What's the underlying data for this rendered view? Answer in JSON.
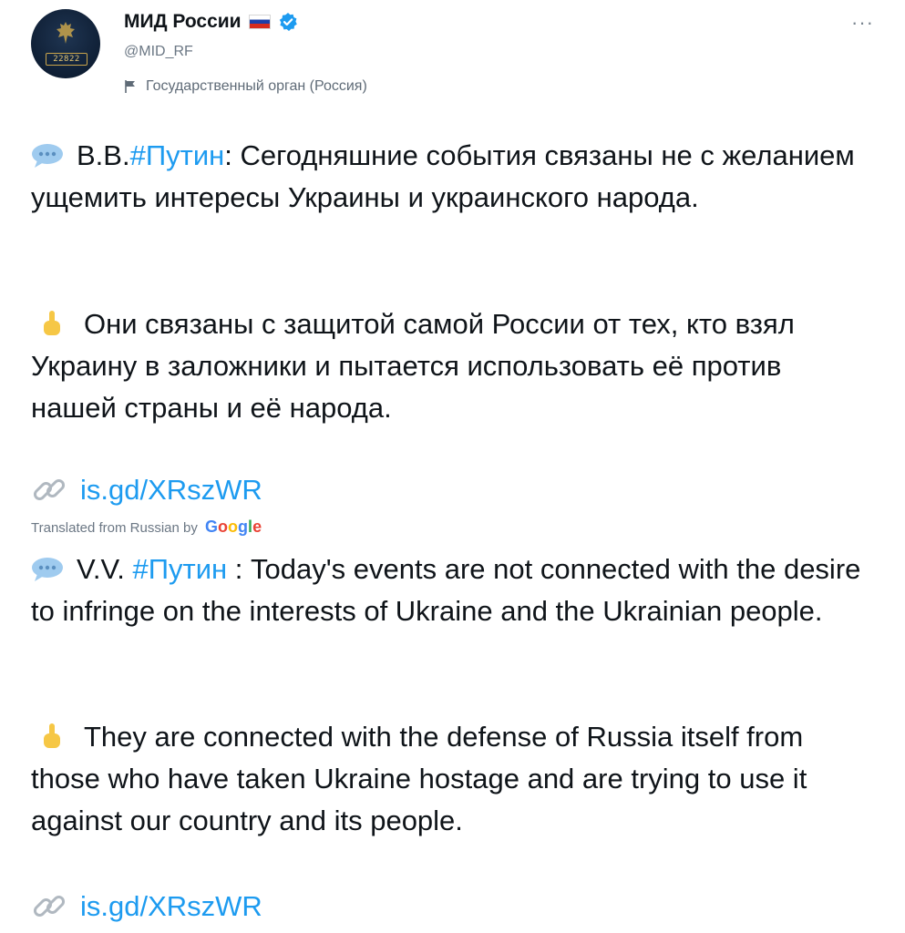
{
  "account": {
    "display_name": "МИД России",
    "handle": "@MID_RF",
    "affiliation": "Государственный орган (Россия)",
    "avatar_plate_text": "22822",
    "more_label": "···"
  },
  "tweet": {
    "ru_p1_before": "В.В.",
    "ru_p1_hashtag": "#Путин",
    "ru_p1_after": ": Сегодняшние события связаны не с желанием ущемить интересы Украины и украинского народа.",
    "ru_p2": "Они связаны с защитой самой России от тех, кто взял Украину в заложники и пытается использовать её против нашей страны и её народа.",
    "link_1": "is.gd/XRszWR",
    "translated_label": "Translated from Russian by",
    "google_letters": [
      "G",
      "o",
      "o",
      "g",
      "l",
      "e"
    ],
    "en_p1_before": "V.V. ",
    "en_p1_hashtag": "#Путин",
    "en_p1_after": " : Today's events are not connected with the desire to infringe on the interests of Ukraine and the Ukrainian people.",
    "en_p2": "They are connected with the defense of Russia itself from those who have taken Ukraine hostage and are trying to use it against our country and its people.",
    "link_2": "is.gd/XRszWR"
  },
  "icons": {
    "verified": "verified-badge-icon",
    "flag": "russia-flag-icon",
    "affiliation": "flag-label-icon",
    "speech": "speech-bubble-icon",
    "pointing": "pointing-up-icon",
    "link": "link-icon"
  },
  "colors": {
    "accent": "#1d9bf0",
    "text": "#0f1419",
    "muted": "#6b7784"
  }
}
